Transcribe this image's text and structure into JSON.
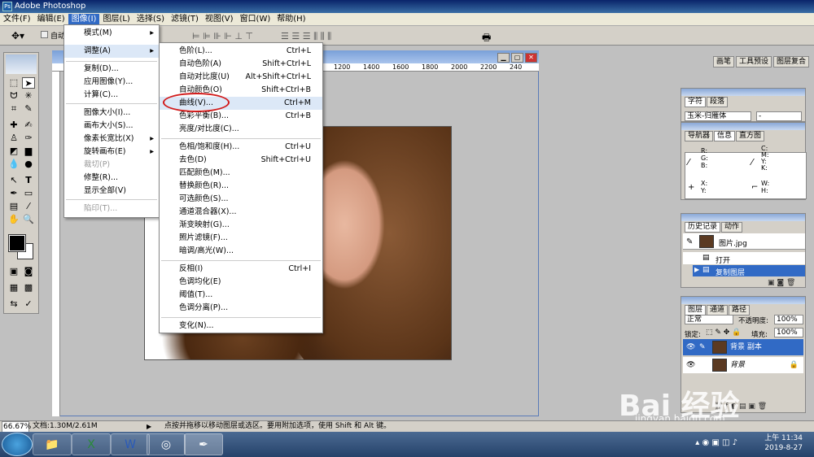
{
  "app": {
    "title": "Adobe Photoshop"
  },
  "menubar": [
    "文件(F)",
    "编辑(E)",
    "图像(I)",
    "图层(L)",
    "选择(S)",
    "滤镜(T)",
    "视图(V)",
    "窗口(W)",
    "帮助(H)"
  ],
  "options": {
    "auto_label": "自动"
  },
  "palette_tabs": [
    "画笔",
    "工具预设",
    "图层复合"
  ],
  "ruler": [
    "1200",
    "1400",
    "1600",
    "1800",
    "2000",
    "2200",
    "240"
  ],
  "image_menu": [
    {
      "label": "模式(M)",
      "arrow": "▸"
    },
    {
      "label": "调整(A)",
      "arrow": "▸"
    },
    {
      "label": "复制(D)..."
    },
    {
      "label": "应用图像(Y)..."
    },
    {
      "label": "计算(C)..."
    },
    {
      "label": "图像大小(I)..."
    },
    {
      "label": "画布大小(S)..."
    },
    {
      "label": "像素长宽比(X)",
      "arrow": "▸"
    },
    {
      "label": "旋转画布(E)",
      "arrow": "▸"
    },
    {
      "label": "裁切(P)"
    },
    {
      "label": "修整(R)..."
    },
    {
      "label": "显示全部(V)"
    },
    {
      "label": "陷印(T)..."
    }
  ],
  "adjust_menu": [
    {
      "label": "色阶(L)...",
      "shortcut": "Ctrl+L"
    },
    {
      "label": "自动色阶(A)",
      "shortcut": "Shift+Ctrl+L"
    },
    {
      "label": "自动对比度(U)",
      "shortcut": "Alt+Shift+Ctrl+L"
    },
    {
      "label": "自动颜色(O)",
      "shortcut": "Shift+Ctrl+B"
    },
    {
      "label": "曲线(V)...",
      "shortcut": "Ctrl+M"
    },
    {
      "label": "色彩平衡(B)...",
      "shortcut": "Ctrl+B"
    },
    {
      "label": "亮度/对比度(C)...",
      "shortcut": ""
    },
    {
      "label": "色相/饱和度(H)...",
      "shortcut": "Ctrl+U"
    },
    {
      "label": "去色(D)",
      "shortcut": "Shift+Ctrl+U"
    },
    {
      "label": "匹配颜色(M)...",
      "shortcut": ""
    },
    {
      "label": "替换颜色(R)...",
      "shortcut": ""
    },
    {
      "label": "可选颜色(S)...",
      "shortcut": ""
    },
    {
      "label": "通道混合器(X)...",
      "shortcut": ""
    },
    {
      "label": "渐变映射(G)...",
      "shortcut": ""
    },
    {
      "label": "照片滤镜(F)...",
      "shortcut": ""
    },
    {
      "label": "暗调/高光(W)...",
      "shortcut": ""
    },
    {
      "label": "反相(I)",
      "shortcut": "Ctrl+I"
    },
    {
      "label": "色调均化(E)",
      "shortcut": ""
    },
    {
      "label": "阈值(T)...",
      "shortcut": ""
    },
    {
      "label": "色调分离(P)...",
      "shortcut": ""
    },
    {
      "label": "变化(N)...",
      "shortcut": ""
    }
  ],
  "char_panel": {
    "tabs": [
      "字符",
      "段落"
    ],
    "font": "玉米-归雁体",
    "size": "-"
  },
  "info_panel": {
    "tabs": [
      "导航器",
      "信息",
      "直方图"
    ],
    "rgb": "R:\nG:\nB:",
    "cmyk": "C:\nM:\nY:\nK:",
    "xy": "X:\nY:",
    "wh": "W:\nH:"
  },
  "history_panel": {
    "tabs": [
      "历史记录",
      "动作"
    ],
    "snapshot": "图片.jpg",
    "items": [
      "打开",
      "复制图层"
    ]
  },
  "layers_panel": {
    "tabs": [
      "图层",
      "通道",
      "路径"
    ],
    "blend": "正常",
    "opacity_label": "不透明度:",
    "opacity": "100%",
    "lock_label": "锁定:",
    "fill_label": "填充:",
    "fill": "100%",
    "layers": [
      "背景 副本",
      "背景"
    ]
  },
  "status": {
    "zoom": "66.67%",
    "doc": "文档:1.30M/2.61M",
    "hint": "点按并拖移以移动图层或选区。要用附加选项，使用 Shift 和 Alt 键。"
  },
  "clock": {
    "time": "上午 11:34",
    "date": "2019-8-27"
  },
  "watermark": {
    "brand": "Bai 经验",
    "url": "jingyan.baidu.com"
  },
  "colors": {
    "accent": "#316ac5",
    "highlight_circle": "#d21a1a"
  }
}
